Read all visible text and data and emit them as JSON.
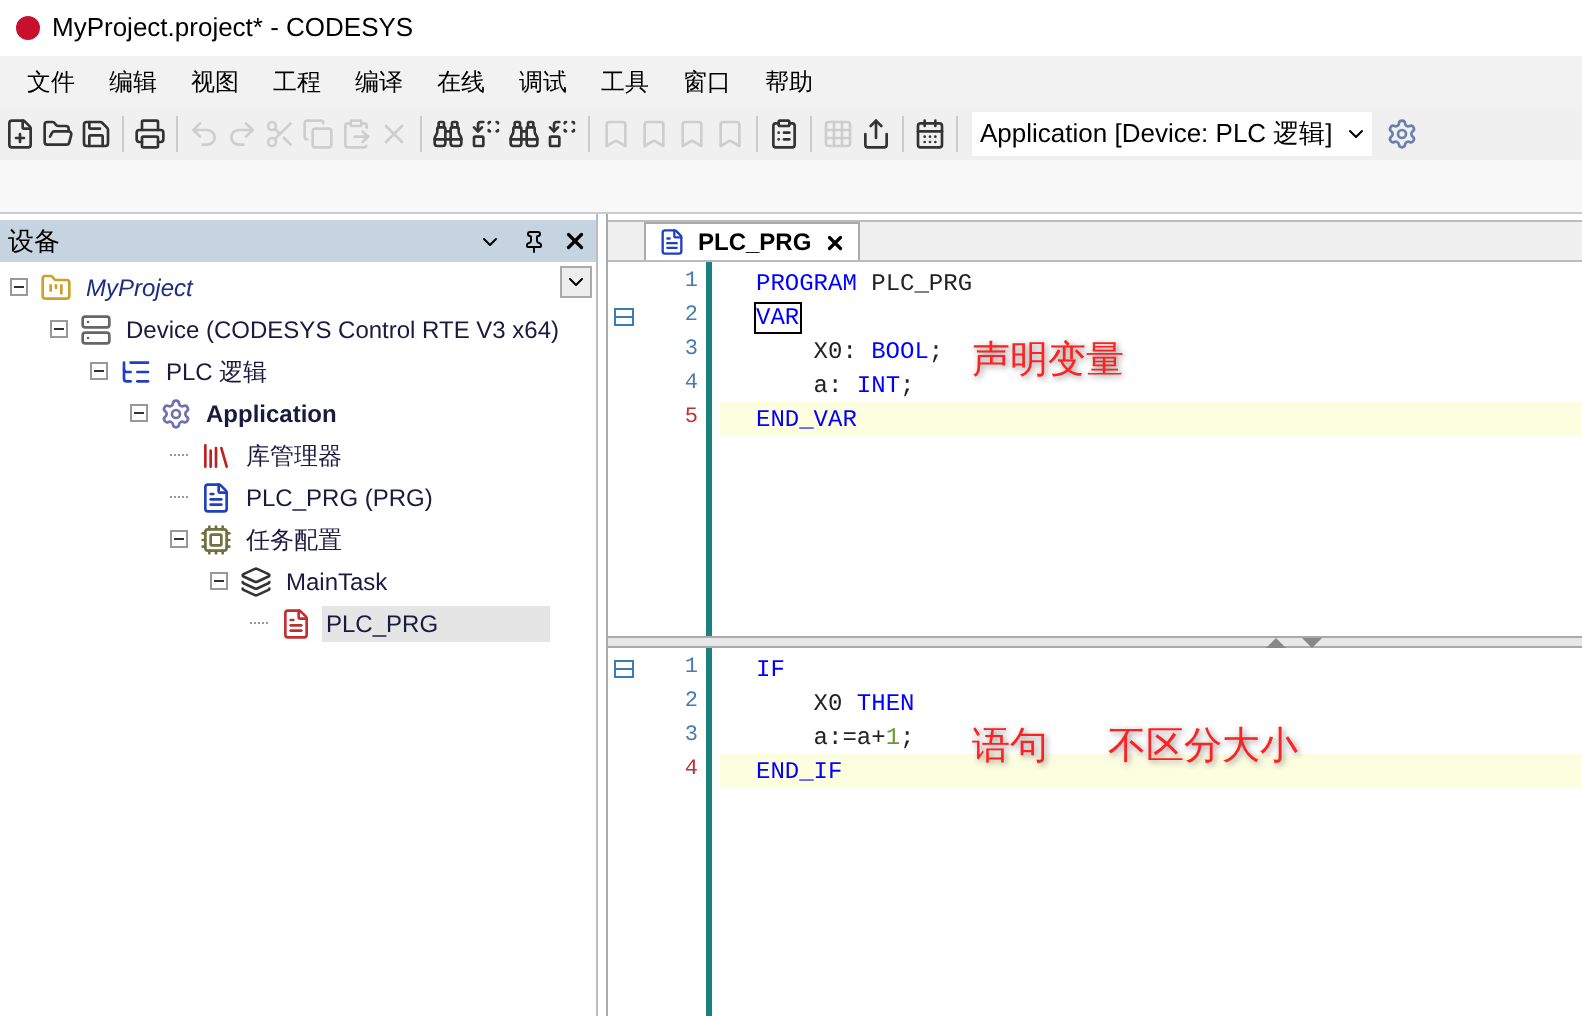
{
  "window": {
    "title": "MyProject.project* - CODESYS"
  },
  "menu": [
    "文件",
    "编辑",
    "视图",
    "工程",
    "编译",
    "在线",
    "调试",
    "工具",
    "窗口",
    "帮助"
  ],
  "toolbar": [
    {
      "kind": "new",
      "disabled": false
    },
    {
      "kind": "open",
      "disabled": false
    },
    {
      "kind": "save",
      "disabled": false
    },
    {
      "kind": "sep"
    },
    {
      "kind": "print",
      "disabled": false
    },
    {
      "kind": "sep"
    },
    {
      "kind": "undo",
      "disabled": true
    },
    {
      "kind": "redo",
      "disabled": true
    },
    {
      "kind": "cut",
      "disabled": true
    },
    {
      "kind": "copy",
      "disabled": true
    },
    {
      "kind": "paste",
      "disabled": true
    },
    {
      "kind": "delete",
      "disabled": true
    },
    {
      "kind": "sep"
    },
    {
      "kind": "find",
      "disabled": false
    },
    {
      "kind": "replace",
      "disabled": false
    },
    {
      "kind": "find",
      "disabled": false
    },
    {
      "kind": "replace",
      "disabled": false
    },
    {
      "kind": "sep"
    },
    {
      "kind": "bookmark",
      "disabled": true
    },
    {
      "kind": "bookmark",
      "disabled": true
    },
    {
      "kind": "bookmark",
      "disabled": true
    },
    {
      "kind": "bookmark",
      "disabled": true
    },
    {
      "kind": "sep"
    },
    {
      "kind": "clipboard",
      "disabled": false
    },
    {
      "kind": "sep"
    },
    {
      "kind": "grid",
      "disabled": true
    },
    {
      "kind": "export",
      "disabled": false
    },
    {
      "kind": "sep"
    },
    {
      "kind": "calendar",
      "disabled": false
    },
    {
      "kind": "sep"
    }
  ],
  "application_selector": {
    "value": "Application [Device: PLC 逻辑]"
  },
  "devices_panel": {
    "title": "设备",
    "tree": [
      {
        "label": "MyProject",
        "kind": "project",
        "expanded": true,
        "selected": false,
        "children": [
          {
            "label": "Device (CODESYS Control RTE V3 x64)",
            "kind": "device",
            "expanded": true,
            "selected": false,
            "children": [
              {
                "label": "PLC 逻辑",
                "kind": "logic",
                "expanded": true,
                "selected": false,
                "children": [
                  {
                    "label": "Application",
                    "kind": "application",
                    "expanded": true,
                    "selected": false,
                    "children": [
                      {
                        "label": "库管理器",
                        "kind": "library",
                        "expanded": false,
                        "selected": false
                      },
                      {
                        "label": "PLC_PRG (PRG)",
                        "kind": "pou",
                        "expanded": false,
                        "selected": false
                      },
                      {
                        "label": "任务配置",
                        "kind": "taskconfig",
                        "expanded": true,
                        "selected": false,
                        "children": [
                          {
                            "label": "MainTask",
                            "kind": "task",
                            "expanded": true,
                            "selected": false,
                            "children": [
                              {
                                "label": "PLC_PRG",
                                "kind": "call",
                                "expanded": false,
                                "selected": true
                              }
                            ]
                          }
                        ]
                      }
                    ]
                  }
                ]
              }
            ]
          }
        ]
      }
    ]
  },
  "editor": {
    "tab": {
      "label": "PLC_PRG",
      "selected": true
    },
    "declaration": {
      "lines": [
        {
          "number": "1",
          "current": false,
          "fold": false,
          "tokens": [
            {
              "text": "PROGRAM",
              "kind": "keyword"
            },
            {
              "text": " PLC_PRG",
              "kind": "plain"
            }
          ]
        },
        {
          "number": "2",
          "current": false,
          "fold": true,
          "tokens": [
            {
              "text": "VAR",
              "kind": "framed"
            }
          ]
        },
        {
          "number": "3",
          "current": false,
          "fold": false,
          "tokens": [
            {
              "text": "    X0: ",
              "kind": "plain"
            },
            {
              "text": "BOOL",
              "kind": "keyword"
            },
            {
              "text": ";",
              "kind": "plain"
            }
          ]
        },
        {
          "number": "4",
          "current": false,
          "fold": false,
          "tokens": [
            {
              "text": "    a: ",
              "kind": "plain"
            },
            {
              "text": "INT",
              "kind": "keyword"
            },
            {
              "text": ";",
              "kind": "plain"
            }
          ]
        },
        {
          "number": "5",
          "current": true,
          "fold": false,
          "tokens": [
            {
              "text": "END_VAR",
              "kind": "keyword"
            }
          ]
        }
      ],
      "annotations": [
        "声明变量"
      ]
    },
    "body": {
      "lines": [
        {
          "number": "1",
          "current": false,
          "fold": true,
          "tokens": [
            {
              "text": "IF",
              "kind": "keyword"
            }
          ]
        },
        {
          "number": "2",
          "current": false,
          "fold": false,
          "tokens": [
            {
              "text": "    X0 ",
              "kind": "plain"
            },
            {
              "text": "THEN",
              "kind": "keyword"
            }
          ]
        },
        {
          "number": "3",
          "current": false,
          "fold": false,
          "tokens": [
            {
              "text": "    a:=a+",
              "kind": "plain"
            },
            {
              "text": "1",
              "kind": "number"
            },
            {
              "text": ";",
              "kind": "plain"
            }
          ]
        },
        {
          "number": "4",
          "current": true,
          "fold": false,
          "tokens": [
            {
              "text": "END_IF",
              "kind": "keyword"
            }
          ]
        }
      ],
      "annotations": [
        "语句",
        "不区分大小"
      ]
    }
  }
}
